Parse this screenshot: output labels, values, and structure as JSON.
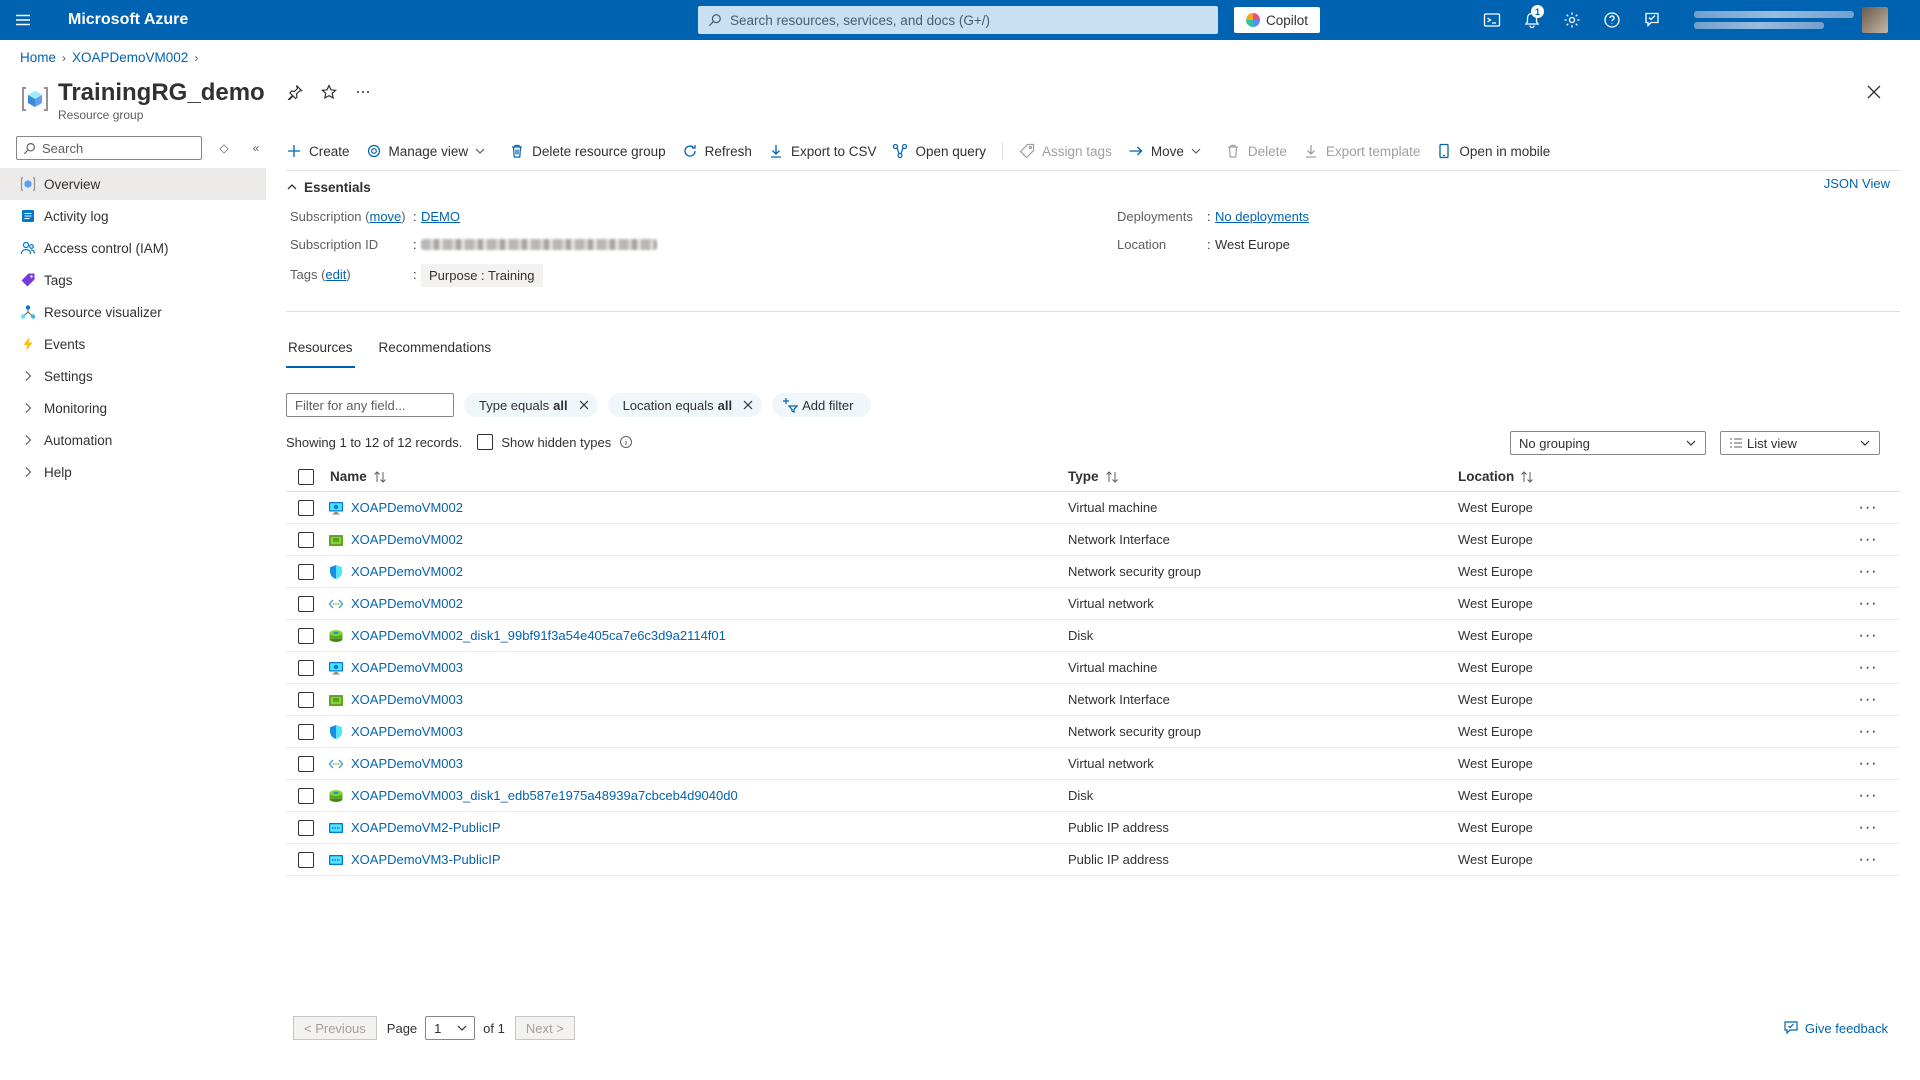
{
  "app": {
    "brand": "Microsoft Azure",
    "search_placeholder": "Search resources, services, and docs (G+/)",
    "copilot_label": "Copilot",
    "notification_count": "1"
  },
  "breadcrumb": {
    "items": [
      "Home",
      "XOAPDemoVM002"
    ]
  },
  "header": {
    "title": "TrainingRG_demo",
    "subtitle": "Resource group"
  },
  "sidebar": {
    "search_placeholder": "Search",
    "items": [
      {
        "label": "Overview",
        "icon": "overview-icon",
        "active": true
      },
      {
        "label": "Activity log",
        "icon": "activity-log-icon"
      },
      {
        "label": "Access control (IAM)",
        "icon": "iam-icon"
      },
      {
        "label": "Tags",
        "icon": "tag-icon"
      },
      {
        "label": "Resource visualizer",
        "icon": "resource-visualizer-icon"
      },
      {
        "label": "Events",
        "icon": "lightning-icon"
      },
      {
        "label": "Settings",
        "icon": "chevron-right-icon"
      },
      {
        "label": "Monitoring",
        "icon": "chevron-right-icon"
      },
      {
        "label": "Automation",
        "icon": "chevron-right-icon"
      },
      {
        "label": "Help",
        "icon": "chevron-right-icon"
      }
    ]
  },
  "toolbar": {
    "create": "Create",
    "manage_view": "Manage view",
    "delete_rg": "Delete resource group",
    "refresh": "Refresh",
    "export_csv": "Export to CSV",
    "open_query": "Open query",
    "assign_tags": "Assign tags",
    "move": "Move",
    "delete": "Delete",
    "export_template": "Export template",
    "open_mobile": "Open in mobile"
  },
  "essentials": {
    "title": "Essentials",
    "json_view": "JSON View",
    "subscription_label": "Subscription",
    "move_link": "move",
    "subscription_value": "DEMO",
    "subscription_id_label": "Subscription ID",
    "tags_label": "Tags",
    "edit_link": "edit",
    "tag_value": "Purpose : Training",
    "deployments_label": "Deployments",
    "deployments_value": "No deployments",
    "location_label": "Location",
    "location_value": "West Europe"
  },
  "tabs": [
    "Resources",
    "Recommendations"
  ],
  "filters": {
    "placeholder": "Filter for any field...",
    "type_pill_prefix": "Type equals",
    "type_pill_value": "all",
    "location_pill_prefix": "Location equals",
    "location_pill_value": "all",
    "add_filter": "Add filter"
  },
  "records": {
    "text": "Showing 1 to 12 of 12 records.",
    "show_hidden": "Show hidden types",
    "grouping": "No grouping",
    "view": "List view"
  },
  "table": {
    "headers": {
      "name": "Name",
      "type": "Type",
      "location": "Location"
    },
    "rows": [
      {
        "name": "XOAPDemoVM002",
        "type": "Virtual machine",
        "location": "West Europe",
        "icon": "vm"
      },
      {
        "name": "XOAPDemoVM002",
        "type": "Network Interface",
        "location": "West Europe",
        "icon": "nic"
      },
      {
        "name": "XOAPDemoVM002",
        "type": "Network security group",
        "location": "West Europe",
        "icon": "nsg"
      },
      {
        "name": "XOAPDemoVM002",
        "type": "Virtual network",
        "location": "West Europe",
        "icon": "vnet"
      },
      {
        "name": "XOAPDemoVM002_disk1_99bf91f3a54e405ca7e6c3d9a2114f01",
        "type": "Disk",
        "location": "West Europe",
        "icon": "disk"
      },
      {
        "name": "XOAPDemoVM003",
        "type": "Virtual machine",
        "location": "West Europe",
        "icon": "vm"
      },
      {
        "name": "XOAPDemoVM003",
        "type": "Network Interface",
        "location": "West Europe",
        "icon": "nic"
      },
      {
        "name": "XOAPDemoVM003",
        "type": "Network security group",
        "location": "West Europe",
        "icon": "nsg"
      },
      {
        "name": "XOAPDemoVM003",
        "type": "Virtual network",
        "location": "West Europe",
        "icon": "vnet"
      },
      {
        "name": "XOAPDemoVM003_disk1_edb587e1975a48939a7cbceb4d9040d0",
        "type": "Disk",
        "location": "West Europe",
        "icon": "disk"
      },
      {
        "name": "XOAPDemoVM2-PublicIP",
        "type": "Public IP address",
        "location": "West Europe",
        "icon": "pip"
      },
      {
        "name": "XOAPDemoVM3-PublicIP",
        "type": "Public IP address",
        "location": "West Europe",
        "icon": "pip"
      }
    ]
  },
  "pagination": {
    "previous": "< Previous",
    "page_label": "Page",
    "current_page": "1",
    "of_label": "of 1",
    "next": "Next >"
  },
  "feedback": "Give feedback",
  "colors": {
    "topbar": "#0063b1",
    "link": "#0063b1",
    "active_nav": "#edebe9"
  }
}
